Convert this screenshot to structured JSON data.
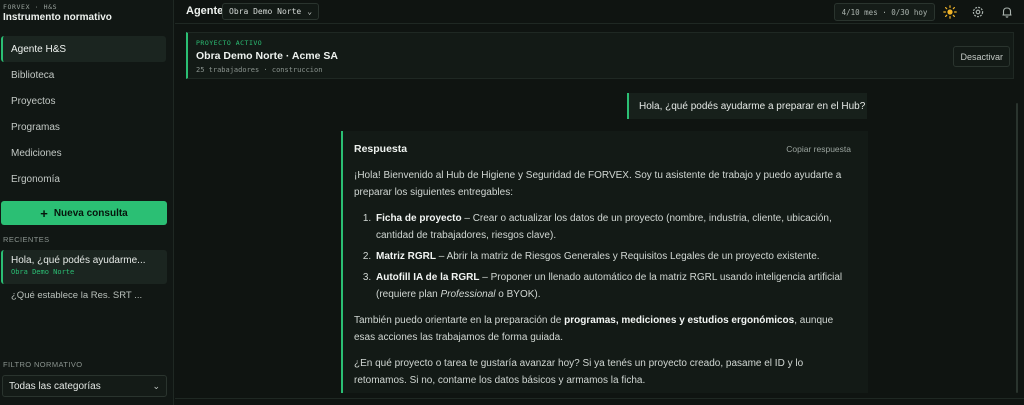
{
  "brand": {
    "top": "FORVEX · H&S",
    "name": "Instrumento normativo"
  },
  "nav": [
    {
      "label": "Agente H&S",
      "active": true
    },
    {
      "label": "Biblioteca"
    },
    {
      "label": "Proyectos"
    },
    {
      "label": "Programas"
    },
    {
      "label": "Mediciones"
    },
    {
      "label": "Ergonomía"
    }
  ],
  "new_button": {
    "label": "Nueva consulta"
  },
  "recientes": {
    "label": "RECIENTES",
    "items": [
      {
        "title": "Hola, ¿qué podés ayudarme...",
        "sub": "Obra Demo Norte"
      },
      {
        "title": "¿Qué establece la Res. SRT ..."
      }
    ]
  },
  "filtro": {
    "label": "FILTRO NORMATIVO",
    "value": "Todas las categorías"
  },
  "header": {
    "agent_label": "Agente",
    "agent_select": "Obra Demo Norte",
    "quota": "4/10 mes · 0/30 hoy"
  },
  "project": {
    "label": "PROYECTO ACTIVO",
    "name": "Obra Demo Norte · Acme SA",
    "meta": "25 trabajadores · construccion",
    "deactivate": "Desactivar"
  },
  "chat": {
    "user_message": "Hola, ¿qué podés ayudarme a preparar en el Hub?",
    "reply_title": "Respuesta",
    "copy_label": "Copiar respuesta",
    "intro": "¡Hola! Bienvenido al Hub de Higiene y Seguridad de FORVEX. Soy tu asistente de trabajo y puedo ayudarte a preparar los siguientes entregables:",
    "items": [
      {
        "bold": "Ficha de proyecto",
        "text": " – Crear o actualizar los datos de un proyecto (nombre, industria, cliente, ubicación, cantidad de trabajadores, riesgos clave)."
      },
      {
        "bold": "Matriz RGRL",
        "text": " – Abrir la matriz de Riesgos Generales y Requisitos Legales de un proyecto existente."
      },
      {
        "bold": "Autofill IA de la RGRL",
        "text": " – Proponer un llenado automático de la matriz RGRL usando inteligencia artificial (requiere plan ",
        "italic": "Professional",
        "tail": " o BYOK)."
      }
    ],
    "p2_start": "También puedo orientarte en la preparación de ",
    "p2_bold": "programas, mediciones y estudios ergonómicos",
    "p2_end": ", aunque esas acciones las trabajamos de forma guiada.",
    "p3": "¿En qué proyecto o tarea te gustaría avanzar hoy? Si ya tenés un proyecto creado, pasame el ID y lo retomamos. Si no, contame los datos básicos y armamos la ficha."
  },
  "colors": {
    "accent": "#2bbf74",
    "bg": "#0f1411",
    "panel": "#131a16"
  },
  "icons": [
    "sun-icon",
    "gear-icon",
    "bell-icon",
    "plus-icon",
    "chevron-down-icon"
  ]
}
